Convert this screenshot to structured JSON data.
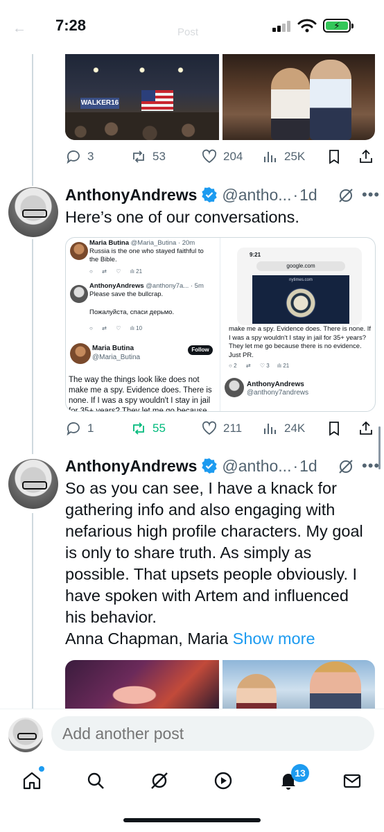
{
  "status_bar": {
    "time": "7:28",
    "ghost_title": "Post"
  },
  "post0": {
    "reply_count": "3",
    "repost_count": "53",
    "like_count": "204",
    "view_count": "25K",
    "banner_text": "WALKER16"
  },
  "post1": {
    "name": "AnthonyAndrews",
    "handle": "@antho...",
    "separator": "·",
    "time_ago": "1d",
    "text": "Here’s one of our conversations.",
    "reply_count": "1",
    "repost_count": "55",
    "like_count": "211",
    "view_count": "24K",
    "embed": {
      "left": {
        "tweet1_name": "Maria Butina",
        "tweet1_meta": "@Maria_Butina · 20m",
        "tweet1_text": "Russia is the one who stayed faithful to the Bible.",
        "tweet1_views": "21",
        "tweet2_name": "AnthonyAndrews",
        "tweet2_meta": "@anthony7a... · 5m",
        "tweet2_text": "Please save the bullcrap.",
        "tweet2_text2": "Пожалуйста, спаси дерьмо.",
        "tweet2_views": "10",
        "profile_name": "Maria Butina",
        "profile_handle": "@Maria_Butina",
        "follow_label": "Follow",
        "quote": "The way the things look like does not make me a spy. Evidence does. There is none. If I was a spy wouldn't I stay in jail for 35+ years? They let me go because there is no"
      },
      "right": {
        "phone_time": "9:21",
        "url": "google.com",
        "site": "nytimes.com",
        "quote": "make me a spy. Evidence does. There is none. If I was a spy wouldn't I stay in jail for 35+ years? They let me go because there is no evidence. Just PR.",
        "reply_count": "2",
        "like_count": "3",
        "view_count": "21",
        "reply_name": "AnthonyAndrews",
        "reply_handle": "@anthony7andrews"
      }
    }
  },
  "post2": {
    "name": "AnthonyAndrews",
    "handle": "@antho...",
    "separator": "·",
    "time_ago": "1d",
    "text": "So as you can see, I have a knack for gathering info and also engaging with nefarious high profile characters. My goal is only to share truth. As simply as possible. That upsets people obviously. I have spoken with Artem and influenced his behavior.",
    "text_last": "Anna Chapman, Maria ",
    "show_more": "Show more"
  },
  "reply_bar": {
    "placeholder": "Add another post"
  },
  "tab_bar": {
    "notif_badge": "13"
  },
  "colors": {
    "accent": "#1d9bf0",
    "repost_active": "#00ba7c",
    "muted": "#536471"
  }
}
